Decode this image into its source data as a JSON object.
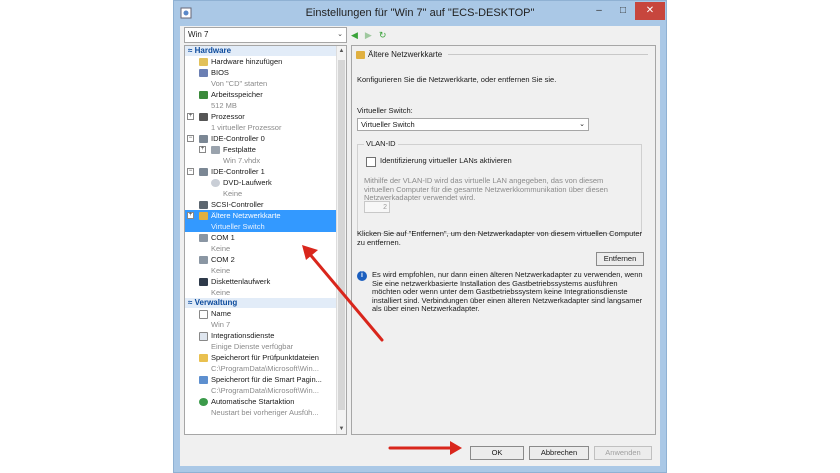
{
  "window": {
    "title": "Einstellungen für \"Win 7\" auf \"ECS-DESKTOP\"",
    "controls": {
      "min": "–",
      "max": "□",
      "close": "✕"
    }
  },
  "vm_selector": {
    "value": "Win 7"
  },
  "tree": {
    "hardware_header": "Hardware",
    "items": [
      {
        "label": "Hardware hinzufügen",
        "sub": "",
        "icon": "hardware-add-icon"
      },
      {
        "label": "BIOS",
        "sub": "Von \"CD\" starten",
        "icon": "bios-icon"
      },
      {
        "label": "Arbeitsspeicher",
        "sub": "512 MB",
        "icon": "memory-icon"
      },
      {
        "label": "Prozessor",
        "sub": "1 virtueller Prozessor",
        "icon": "processor-icon"
      },
      {
        "label": "IDE-Controller 0",
        "sub": "",
        "icon": "ide-controller-icon"
      },
      {
        "label": "Festplatte",
        "sub": "Win 7.vhdx",
        "icon": "hard-disk-icon"
      },
      {
        "label": "IDE-Controller 1",
        "sub": "",
        "icon": "ide-controller-icon"
      },
      {
        "label": "DVD-Laufwerk",
        "sub": "Keine",
        "icon": "dvd-drive-icon"
      },
      {
        "label": "SCSI-Controller",
        "sub": "",
        "icon": "scsi-controller-icon"
      },
      {
        "label": "Ältere Netzwerkkarte",
        "sub": "Virtueller Switch",
        "icon": "legacy-network-adapter-icon"
      },
      {
        "label": "COM 1",
        "sub": "Keine",
        "icon": "com-port-icon"
      },
      {
        "label": "COM 2",
        "sub": "Keine",
        "icon": "com-port-icon"
      },
      {
        "label": "Diskettenlaufwerk",
        "sub": "Keine",
        "icon": "floppy-drive-icon"
      }
    ],
    "management_header": "Verwaltung",
    "mgmt_items": [
      {
        "label": "Name",
        "sub": "Win 7",
        "icon": "name-icon"
      },
      {
        "label": "Integrationsdienste",
        "sub": "Einige Dienste verfügbar",
        "icon": "integration-services-icon"
      },
      {
        "label": "Speicherort für Prüfpunktdateien",
        "sub": "C:\\ProgramData\\Microsoft\\Win...",
        "icon": "checkpoint-folder-icon"
      },
      {
        "label": "Speicherort für die Smart Pagin...",
        "sub": "C:\\ProgramData\\Microsoft\\Win...",
        "icon": "smart-paging-folder-icon"
      },
      {
        "label": "Automatische Startaktion",
        "sub": "Neustart bei vorheriger Ausfüh...",
        "icon": "auto-start-icon"
      }
    ]
  },
  "panel": {
    "header": "Ältere Netzwerkkarte",
    "intro": "Konfigurieren Sie die Netzwerkkarte, oder entfernen Sie sie.",
    "switch_label": "Virtueller Switch:",
    "switch_value": "Virtueller Switch",
    "vlan_group": "VLAN-ID",
    "vlan_checkbox": "Identifizierung virtueller LANs aktivieren",
    "vlan_help": "Mithilfe der VLAN-ID wird das virtuelle LAN angegeben, das von diesem virtuellen Computer für die gesamte Netzwerkkommunikation über diesen Netzwerkadapter verwendet wird.",
    "vlan_value": "2",
    "remove_text": "Klicken Sie auf \"Entfernen\", um den Netzwerkadapter von diesem virtuellen Computer zu entfernen.",
    "remove_button": "Entfernen",
    "info_text": "Es wird empfohlen, nur dann einen älteren Netzwerkadapter zu verwenden, wenn Sie eine netzwerkbasierte Installation des Gastbetriebssystems ausführen möchten oder wenn unter dem Gastbetriebssystem keine Integrationsdienste installiert sind. Verbindungen über einen älteren Netzwerkadapter sind langsamer als über einen Netzwerkadapter."
  },
  "footer": {
    "ok": "OK",
    "cancel": "Abbrechen",
    "apply": "Anwenden"
  },
  "colors": {
    "selection": "#3399ff",
    "arrow": "#d9261c",
    "section_header": "#0b4a9c"
  }
}
